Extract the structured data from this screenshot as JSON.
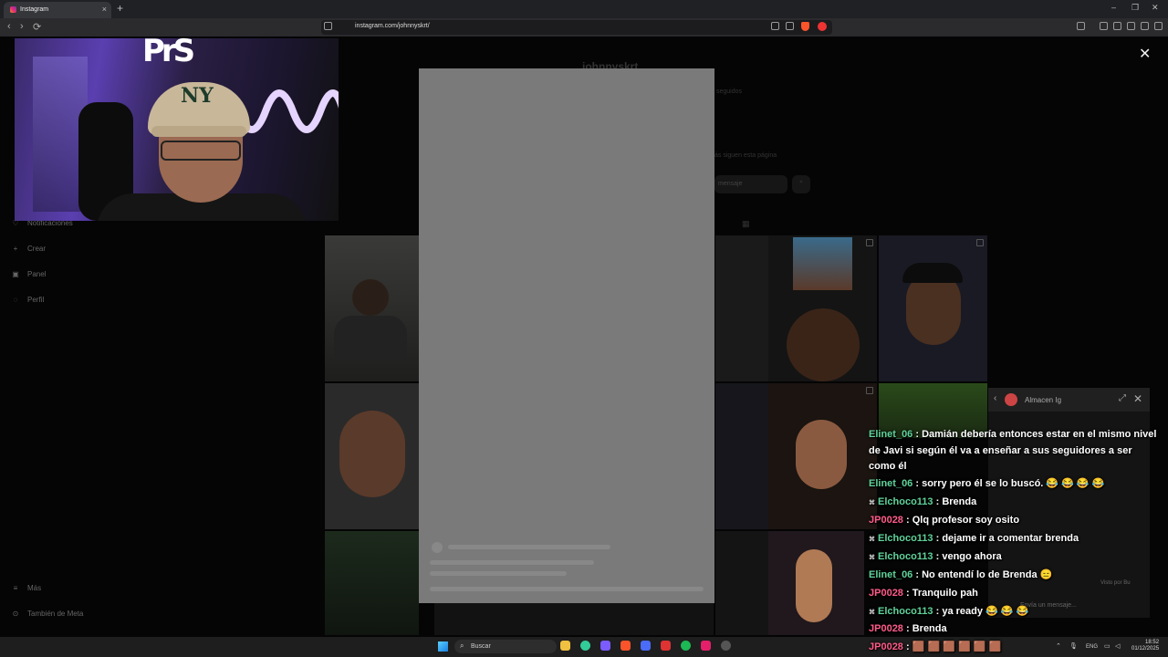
{
  "browser": {
    "tab_title": "Instagram",
    "new_tab": "+",
    "tab_close": "×",
    "url": "instagram.com/johnnyskrt/",
    "nav_back": "‹",
    "nav_forward": "›",
    "nav_reload": "⟳",
    "win_min": "–",
    "win_max": "❐",
    "win_close": "✕"
  },
  "instagram": {
    "sidebar": [
      {
        "label": "Notificaciones",
        "icon": "heart-icon",
        "glyph": "♡"
      },
      {
        "label": "Crear",
        "icon": "plus-icon",
        "glyph": "+"
      },
      {
        "label": "Panel",
        "icon": "dashboard-icon",
        "glyph": "▣"
      },
      {
        "label": "Perfil",
        "icon": "profile-icon",
        "glyph": "◌"
      },
      {
        "label": "Más",
        "icon": "menu-icon",
        "glyph": "≡"
      },
      {
        "label": "También de Meta",
        "icon": "meta-icon",
        "glyph": "⊙"
      }
    ],
    "profile_username": "johnnyskrt",
    "seguidos_label": "seguidos",
    "followers_note": "ás siguen esta página",
    "message_button": "mensaje",
    "modal_close": "✕"
  },
  "overlay": {
    "logo": "PrS",
    "cap_logo": "NY"
  },
  "chat_panel": {
    "title": "Almacen Ig",
    "back": "‹",
    "expand": "⤢",
    "close": "✕",
    "input_placeholder": "Envía un mensaje...",
    "seen_by": "Visto por Bu"
  },
  "chat": [
    {
      "user": "Elinet_06",
      "color": "green",
      "badge": false,
      "text": "Damián debería entonces estar en el mismo nivel de Javi si según él va a enseñar a sus seguidores a ser como él"
    },
    {
      "user": "Elinet_06",
      "color": "green",
      "badge": false,
      "text": "sorry pero él se lo buscó. 😂 😂 😂 😂"
    },
    {
      "user": "Elchoco113",
      "color": "green",
      "badge": true,
      "text": "Brenda"
    },
    {
      "user": "JP0028",
      "color": "pink",
      "badge": false,
      "text": "Qlq profesor soy osito"
    },
    {
      "user": "Elchoco113",
      "color": "green",
      "badge": true,
      "text": "dejame ir a comentar brenda"
    },
    {
      "user": "Elchoco113",
      "color": "green",
      "badge": true,
      "text": "vengo ahora"
    },
    {
      "user": "Elinet_06",
      "color": "green",
      "badge": false,
      "text": "No entendí lo de Brenda 😑"
    },
    {
      "user": "JP0028",
      "color": "pink",
      "badge": false,
      "text": "Tranquilo pah"
    },
    {
      "user": "Elchoco113",
      "color": "green",
      "badge": true,
      "text": "ya ready 😂 😂 😂"
    },
    {
      "user": "JP0028",
      "color": "pink",
      "badge": false,
      "text": "Brenda"
    },
    {
      "user": "JP0028",
      "color": "pink",
      "badge": false,
      "text": "🟫 🟫 🟫 🟫 🟫 🟫"
    }
  ],
  "taskbar": {
    "search_label": "Buscar",
    "language": "ENG",
    "time": "18:52",
    "date": "01/12/2025"
  },
  "colors": {
    "chat_green": "#5fd39a",
    "chat_pink": "#ff5b8a",
    "modal_gray": "#7a7a7a"
  }
}
